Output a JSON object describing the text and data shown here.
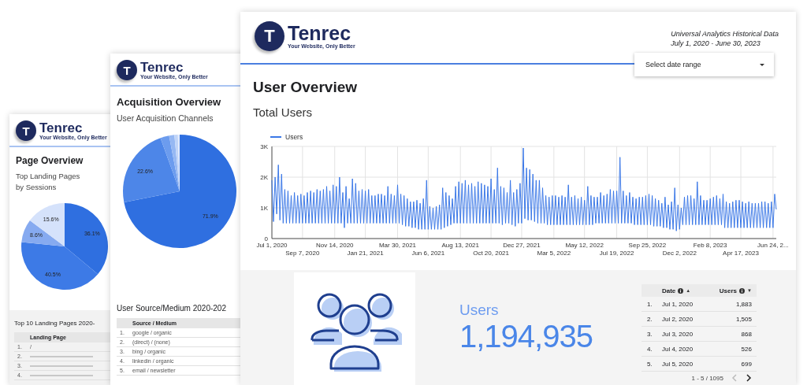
{
  "back_page": {
    "logo": {
      "mark": "T",
      "name": "Tenrec",
      "tagline": "Your Website, Only Better"
    },
    "title": "Page Overview",
    "chart_title_lines": [
      "Top Landing Pages",
      "by Sessions"
    ],
    "pie": {
      "slice_labels": [
        "36.1%",
        "40.5%",
        "8.6%",
        "15.6%"
      ]
    },
    "table": {
      "title": "Top 10 Landing Pages 2020-",
      "header": "Landing Page",
      "rows": [
        {
          "rank": "1.",
          "page": "/"
        },
        {
          "rank": "2."
        },
        {
          "rank": "3."
        },
        {
          "rank": "4."
        }
      ]
    }
  },
  "middle_page": {
    "logo": {
      "mark": "T",
      "name": "Tenrec",
      "tagline": "Your Website, Only Better"
    },
    "title": "Acquisition Overview",
    "chart_title_lines": [
      "User Acquisition Channels"
    ],
    "pie": {
      "slice_labels": [
        "71.9%",
        "22.6%"
      ]
    },
    "table": {
      "title": "User Source/Medium 2020-202",
      "header": "Source / Medium",
      "rows": [
        {
          "rank": "1.",
          "page": "google / organic"
        },
        {
          "rank": "2.",
          "page": "(direct) / (none)"
        },
        {
          "rank": "3.",
          "page": "bing / organic"
        },
        {
          "rank": "4.",
          "page": "linkedin / organic"
        },
        {
          "rank": "5.",
          "page": "email / newsletter"
        }
      ]
    }
  },
  "front_page": {
    "logo": {
      "mark": "T",
      "name": "Tenrec",
      "tagline": "Your Website, Only Better"
    },
    "data_note_lines": [
      "Universal Analytics Historical Data",
      "July 1, 2020 - June 30, 2023"
    ],
    "date_dropdown": {
      "label": "Select date range"
    },
    "title": "User Overview",
    "chart_title": "Total Users",
    "chart_data": {
      "type": "line",
      "ylim": [
        0,
        3000
      ],
      "categories": [
        "Jul 1, 2020",
        null,
        null,
        null,
        null,
        null,
        null,
        null,
        null,
        null,
        null,
        null,
        null,
        null,
        null,
        null,
        null,
        null,
        null,
        "Sep 7, 2020",
        null,
        null,
        null,
        null,
        null,
        null,
        null,
        null,
        null,
        null,
        null,
        null,
        null,
        null,
        null,
        null,
        null,
        null,
        null,
        "Nov 14, 2020",
        null,
        null,
        null,
        null,
        null,
        null,
        null,
        null,
        null,
        null,
        null,
        null,
        null,
        null,
        null,
        null,
        null,
        null,
        "Jan 21, 2021",
        null,
        null,
        null,
        null,
        null,
        null,
        null,
        null,
        null,
        null,
        null,
        null,
        null,
        null,
        null,
        null,
        null,
        null,
        null,
        "Mar 30, 2021",
        null,
        null,
        null,
        null,
        null,
        null,
        null,
        null,
        null,
        null,
        null,
        null,
        null,
        null,
        null,
        null,
        null,
        null,
        "Jun 6, 2021",
        null,
        null,
        null,
        null,
        null,
        null,
        null,
        null,
        null,
        null,
        null,
        null,
        null,
        null,
        null,
        null,
        null,
        null,
        null,
        "Aug 13, 2021",
        null,
        null,
        null,
        null,
        null,
        null,
        null,
        null,
        null,
        null,
        null,
        null,
        null,
        null,
        null,
        null,
        null,
        null,
        "Oct 20, 2021",
        null,
        null,
        null,
        null,
        null,
        null,
        null,
        null,
        null,
        null,
        null,
        null,
        null,
        null,
        null,
        null,
        null,
        null,
        "Dec 27, 2021",
        null,
        null,
        null,
        null,
        null,
        null,
        null,
        null,
        null,
        null,
        null,
        null,
        null,
        null,
        null,
        null,
        null,
        null,
        null,
        "Mar 5, 2022",
        null,
        null,
        null,
        null,
        null,
        null,
        null,
        null,
        null,
        null,
        null,
        null,
        null,
        null,
        null,
        null,
        null,
        null,
        "May 12, 2022",
        null,
        null,
        null,
        null,
        null,
        null,
        null,
        null,
        null,
        null,
        null,
        null,
        null,
        null,
        null,
        null,
        null,
        null,
        null,
        "Jul 19, 2022",
        null,
        null,
        null,
        null,
        null,
        null,
        null,
        null,
        null,
        null,
        null,
        null,
        null,
        null,
        null,
        null,
        null,
        null,
        "Sep 25, 2022",
        null,
        null,
        null,
        null,
        null,
        null,
        null,
        null,
        null,
        null,
        null,
        null,
        null,
        null,
        null,
        null,
        null,
        null,
        null,
        "Dec 2, 2022",
        null,
        null,
        null,
        null,
        null,
        null,
        null,
        null,
        null,
        null,
        null,
        null,
        null,
        null,
        null,
        null,
        null,
        null,
        "Feb 8, 2023",
        null,
        null,
        null,
        null,
        null,
        null,
        null,
        null,
        null,
        null,
        null,
        null,
        null,
        null,
        null,
        null,
        null,
        null,
        "Apr 17, 2023",
        null,
        null,
        null,
        null,
        null,
        null,
        null,
        null,
        null,
        null,
        null,
        null,
        null,
        null,
        null,
        null,
        null,
        null,
        null,
        "Jun 24, 2...",
        null,
        null
      ],
      "yticks": [
        {
          "value": 0,
          "label": "0"
        },
        {
          "value": 1000,
          "label": "1K"
        },
        {
          "value": 2000,
          "label": "2K"
        },
        {
          "value": 3000,
          "label": "3K"
        }
      ],
      "series": [
        {
          "name": "Users",
          "color": "#3b78e7",
          "values": [
            1900,
            550,
            2000,
            800,
            2400,
            600,
            2100,
            500,
            1600,
            500,
            1550,
            500,
            1400,
            500,
            1500,
            500,
            1400,
            500,
            1450,
            500,
            1400,
            500,
            1500,
            500,
            1550,
            500,
            1500,
            500,
            1600,
            500,
            1550,
            500,
            1600,
            500,
            1700,
            500,
            1550,
            500,
            1750,
            500,
            1700,
            500,
            2000,
            500,
            1500,
            350,
            1700,
            500,
            1300,
            500,
            1950,
            500,
            1800,
            500,
            1550,
            500,
            1600,
            500,
            1550,
            500,
            1600,
            500,
            1400,
            500,
            1400,
            500,
            1450,
            500,
            1450,
            500,
            1400,
            500,
            1700,
            500,
            1450,
            500,
            1400,
            500,
            1750,
            500,
            1450,
            450,
            1400,
            400,
            1300,
            400,
            1200,
            350,
            1200,
            350,
            1250,
            300,
            1150,
            300,
            1300,
            300,
            1900,
            300,
            1050,
            300,
            1000,
            300,
            1050,
            300,
            1100,
            300,
            1650,
            350,
            1500,
            400,
            1400,
            450,
            1300,
            500,
            1700,
            500,
            1850,
            500,
            1800,
            500,
            1900,
            500,
            1750,
            500,
            1800,
            500,
            1700,
            500,
            1850,
            500,
            1800,
            500,
            1750,
            500,
            1700,
            500,
            1950,
            500,
            1600,
            500,
            2300,
            500,
            1700,
            450,
            1650,
            500,
            1500,
            500,
            1900,
            450,
            1500,
            400,
            1600,
            500,
            1800,
            500,
            2950,
            650,
            2300,
            600,
            2250,
            600,
            2100,
            550,
            1900,
            500,
            1900,
            500,
            1650,
            500,
            1400,
            450,
            1350,
            450,
            1400,
            450,
            1400,
            450,
            1350,
            450,
            1400,
            450,
            1350,
            450,
            1750,
            450,
            1350,
            450,
            1400,
            450,
            1300,
            450,
            1350,
            450,
            1250,
            450,
            1700,
            450,
            1400,
            450,
            1350,
            500,
            1350,
            500,
            1500,
            500,
            1400,
            500,
            1450,
            500,
            1600,
            500,
            1550,
            500,
            1550,
            500,
            2650,
            500,
            1550,
            500,
            1400,
            500,
            1500,
            500,
            1350,
            450,
            1300,
            450,
            1350,
            450,
            1350,
            450,
            1400,
            450,
            1450,
            450,
            1400,
            400,
            1300,
            400,
            1250,
            400,
            1150,
            350,
            1350,
            350,
            1100,
            300,
            1200,
            300,
            1650,
            250,
            1100,
            300,
            1000,
            450,
            1350,
            450,
            1400,
            450,
            1400,
            450,
            1300,
            450,
            1850,
            450,
            1400,
            450,
            1250,
            450,
            1250,
            450,
            1300,
            450,
            1350,
            450,
            1400,
            450,
            1300,
            450,
            1450,
            350,
            1200,
            350,
            1150,
            350,
            1200,
            350,
            1250,
            350,
            1250,
            350,
            1200,
            350,
            1150,
            350,
            1200,
            350,
            1150,
            350,
            1150,
            350,
            1150,
            350,
            1200,
            350,
            1200,
            350,
            1150,
            350,
            1200,
            350,
            1450,
            950
          ]
        }
      ]
    },
    "scorecard": {
      "label": "Users",
      "value": "1,194,935"
    },
    "table": {
      "columns": [
        {
          "label": "Date",
          "sort_indicator": "▲"
        },
        {
          "label": "Users",
          "sort_indicator": "▼"
        }
      ],
      "rows": [
        {
          "rank": "1.",
          "date": "Jul 1, 2020",
          "users": "1,883"
        },
        {
          "rank": "2.",
          "date": "Jul 2, 2020",
          "users": "1,505"
        },
        {
          "rank": "3.",
          "date": "Jul 3, 2020",
          "users": "868"
        },
        {
          "rank": "4.",
          "date": "Jul 4, 2020",
          "users": "526"
        },
        {
          "rank": "5.",
          "date": "Jul 5, 2020",
          "users": "699"
        }
      ],
      "pagination": "1 - 5 / 1095"
    }
  }
}
